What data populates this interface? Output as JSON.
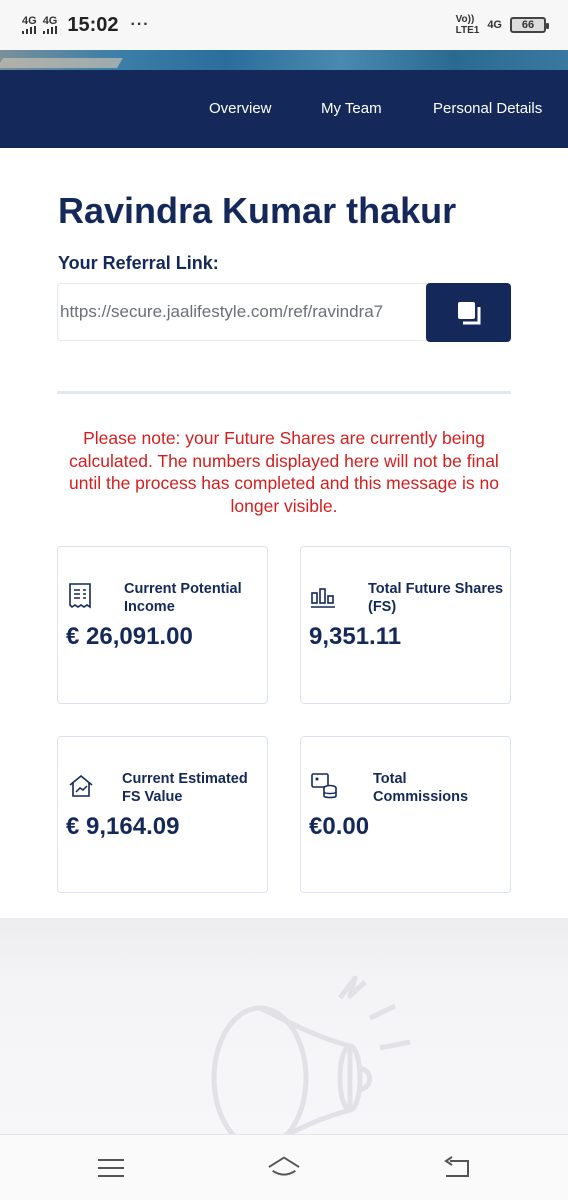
{
  "status_bar": {
    "network_1": "4G",
    "network_2": "4G",
    "time": "15:02",
    "dots": "···",
    "volte_top": "Vo))",
    "volte_bottom": "LTE1",
    "network_right": "4G",
    "battery": "66"
  },
  "nav": {
    "overview": "Overview",
    "my_team": "My Team",
    "personal_details": "Personal Details"
  },
  "profile": {
    "name": "Ravindra Kumar thakur",
    "referral_label": "Your Referral Link:",
    "referral_link": "https://secure.jaalifestyle.com/ref/ravindra7"
  },
  "notice": "Please note: your Future Shares are currently being calculated. The numbers displayed here will not be final until the process has completed and this message is no longer visible.",
  "cards": {
    "income": {
      "label": "Current Potential Income",
      "value": "€ 26,091.00",
      "icon": "receipt-icon"
    },
    "future_shares": {
      "label": "Total Future Shares (FS)",
      "value": "9,351.11",
      "icon": "bar-chart-icon"
    },
    "fs_value": {
      "label": "Current Estimated FS Value",
      "value": "€ 9,164.09",
      "icon": "house-chart-icon"
    },
    "commissions": {
      "label": "Total Commissions",
      "value": "€0.00",
      "icon": "coins-icon"
    }
  },
  "colors": {
    "navy": "#14295a",
    "notice_red": "#d41f1f"
  }
}
